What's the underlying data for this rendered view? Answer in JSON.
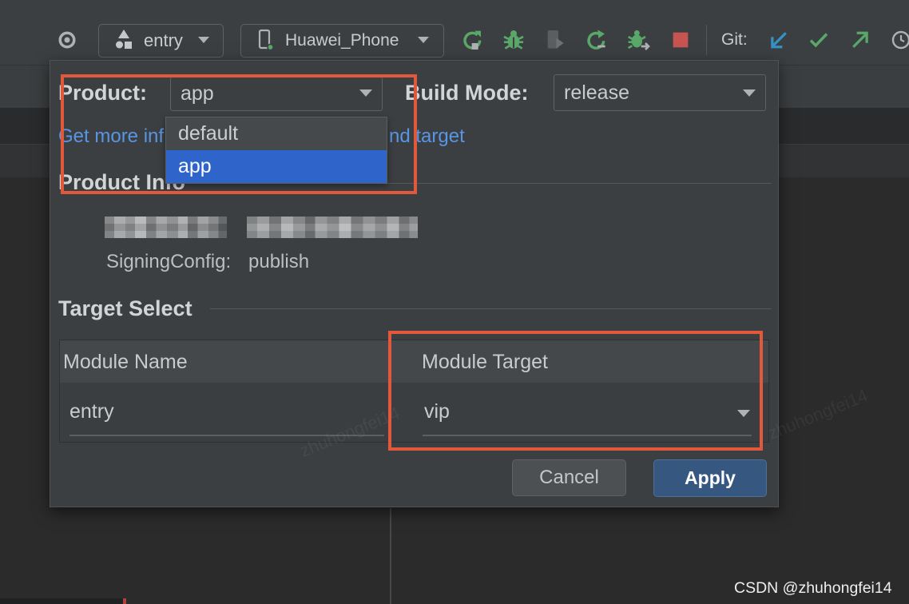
{
  "toolbar": {
    "locate_icon": "locate-icon",
    "module_selector": {
      "icon": "module-icon",
      "value": "entry"
    },
    "device_selector": {
      "icon": "phone-icon",
      "value": "Huawei_Phone"
    },
    "actions": [
      "rerun-icon",
      "debug-icon",
      "attach-debugger-icon",
      "apply-changes-icon",
      "debug-attach-icon",
      "stop-icon"
    ],
    "git_label": "Git:",
    "git_actions": [
      "git-update-icon",
      "git-commit-icon",
      "git-push-icon",
      "history-icon"
    ]
  },
  "dialog": {
    "product": {
      "label": "Product:",
      "value": "app",
      "options": [
        "default",
        "app"
      ]
    },
    "build_mode": {
      "label": "Build Mode:",
      "value": "release"
    },
    "help_link": {
      "visible_start": "Get more inf",
      "visible_end": "nd target"
    },
    "product_info": {
      "title": "Product Info",
      "signing_config_label": "SigningConfig:",
      "signing_config_value": "publish"
    },
    "target_select": {
      "title": "Target Select",
      "columns": [
        "Module Name",
        "Module Target"
      ],
      "rows": [
        {
          "module_name": "entry",
          "module_target": "vip"
        }
      ]
    },
    "buttons": {
      "cancel": "Cancel",
      "apply": "Apply"
    }
  },
  "watermark": {
    "text": "zhuhongfei14",
    "credit": "CSDN @zhuhongfei14"
  },
  "colors": {
    "annotation_box": "#e2583b",
    "link": "#5995e5",
    "selection": "#2f65ca",
    "primary_button": "#365880",
    "run_green": "#59a869",
    "stop_red": "#c75450",
    "git_update_blue": "#3592c4"
  }
}
